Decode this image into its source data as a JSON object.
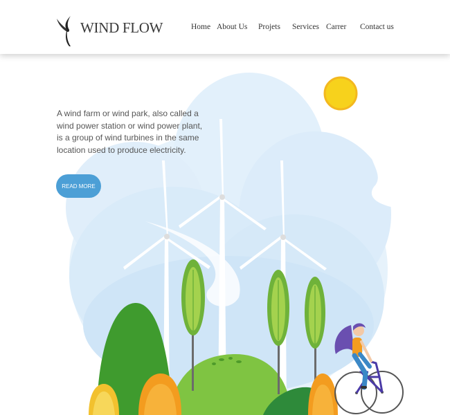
{
  "brand": {
    "name": "WIND FLOW",
    "logo_icon": "wind-turbine-logo-icon"
  },
  "nav": {
    "items": [
      "Home",
      "About Us",
      "Projets",
      "Services",
      "Carrer",
      "Contact us"
    ]
  },
  "hero": {
    "intro": "A wind farm or wind park, also called a wind power station or wind power plant, is a group of wind turbines in the same location used to produce electricity.",
    "cta_label": "READ MORE",
    "illustration": "wind-turbines-landscape-with-cyclist"
  },
  "colors": {
    "accent": "#4c9fd6",
    "sun": "#f7d21c",
    "hill_green": "#3f9b2e",
    "cloud_blue": "#e3f1fb"
  }
}
